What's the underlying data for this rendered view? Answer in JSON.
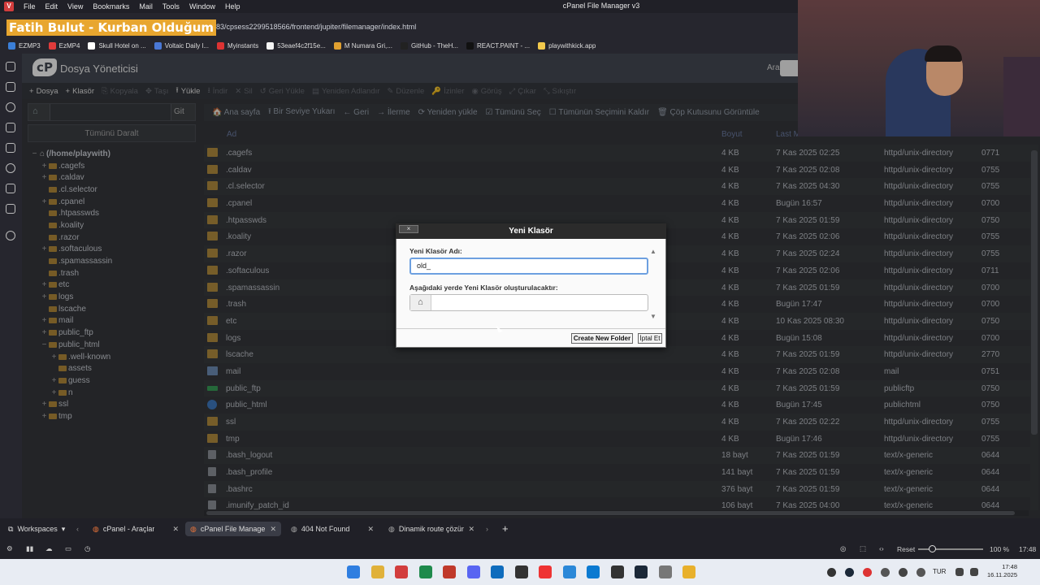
{
  "menubar": {
    "items": [
      "File",
      "Edit",
      "View",
      "Bookmarks",
      "Mail",
      "Tools",
      "Window",
      "Help"
    ],
    "window_title": "cPanel File Manager v3"
  },
  "overlay": {
    "streamer_name": "Fatih Bulut - Kurban Olduğum"
  },
  "address": {
    "url": ".app:2083/cpsess2299518566/frontend/jupiter/filemanager/index.html"
  },
  "bookmarks": [
    {
      "label": "EZMP3",
      "color": "#3b7fd8"
    },
    {
      "label": "EzMP4",
      "color": "#e03b3b"
    },
    {
      "label": "Skull Hotel on ...",
      "color": "#ffffff"
    },
    {
      "label": "Voltaic Daily l...",
      "color": "#4a78d6"
    },
    {
      "label": "Myinstants",
      "color": "#d33"
    },
    {
      "label": "53eaef4c2f15e...",
      "color": "#f5f5f5"
    },
    {
      "label": "M Numara Gri,...",
      "color": "#e0a030"
    },
    {
      "label": "GitHub - TheH...",
      "color": "#222"
    },
    {
      "label": "REACT.PAINT - ...",
      "color": "#111"
    },
    {
      "label": "playwithkick.app",
      "color": "#f2c94c"
    }
  ],
  "cpanel": {
    "logo_text": "cP",
    "title": "Dosya Yöneticisi",
    "search_label": "Ara",
    "search_placeholder": "Tü"
  },
  "toolbar": [
    {
      "label": "Dosya",
      "icon": "+",
      "enabled": true
    },
    {
      "label": "Klasör",
      "icon": "+",
      "enabled": true
    },
    {
      "label": "Kopyala",
      "icon": "⎘",
      "enabled": false
    },
    {
      "label": "Taşı",
      "icon": "✥",
      "enabled": false
    },
    {
      "label": "Yükle",
      "icon": "⭱",
      "enabled": true
    },
    {
      "label": "İndir",
      "icon": "⭳",
      "enabled": false
    },
    {
      "label": "Sil",
      "icon": "✕",
      "enabled": false
    },
    {
      "label": "Geri Yükle",
      "icon": "↺",
      "enabled": false
    },
    {
      "label": "Yeniden Adlandır",
      "icon": "▤",
      "enabled": false
    },
    {
      "label": "Düzenle",
      "icon": "✎",
      "enabled": false
    },
    {
      "label": "İzinler",
      "icon": "🔑",
      "enabled": false
    },
    {
      "label": "Görüş",
      "icon": "◉",
      "enabled": false
    },
    {
      "label": "Çıkar",
      "icon": "⤢",
      "enabled": false
    },
    {
      "label": "Sıkıştır",
      "icon": "⤡",
      "enabled": false
    }
  ],
  "tree_nav": {
    "go_label": "Git",
    "collapse_label": "Tümünü Daralt"
  },
  "tree": [
    {
      "label": "(/home/playwith)",
      "indent": 0,
      "pm": "−",
      "home": true
    },
    {
      "label": ".cagefs",
      "indent": 1,
      "pm": "+"
    },
    {
      "label": ".caldav",
      "indent": 1,
      "pm": "+"
    },
    {
      "label": ".cl.selector",
      "indent": 1,
      "pm": ""
    },
    {
      "label": ".cpanel",
      "indent": 1,
      "pm": "+"
    },
    {
      "label": ".htpasswds",
      "indent": 1,
      "pm": ""
    },
    {
      "label": ".koality",
      "indent": 1,
      "pm": ""
    },
    {
      "label": ".razor",
      "indent": 1,
      "pm": ""
    },
    {
      "label": ".softaculous",
      "indent": 1,
      "pm": "+"
    },
    {
      "label": ".spamassassin",
      "indent": 1,
      "pm": ""
    },
    {
      "label": ".trash",
      "indent": 1,
      "pm": ""
    },
    {
      "label": "etc",
      "indent": 1,
      "pm": "+"
    },
    {
      "label": "logs",
      "indent": 1,
      "pm": "+"
    },
    {
      "label": "lscache",
      "indent": 1,
      "pm": ""
    },
    {
      "label": "mail",
      "indent": 1,
      "pm": "+"
    },
    {
      "label": "public_ftp",
      "indent": 1,
      "pm": "+"
    },
    {
      "label": "public_html",
      "indent": 1,
      "pm": "−"
    },
    {
      "label": ".well-known",
      "indent": 2,
      "pm": "+"
    },
    {
      "label": "assets",
      "indent": 2,
      "pm": ""
    },
    {
      "label": "guess",
      "indent": 2,
      "pm": "+"
    },
    {
      "label": "n",
      "indent": 2,
      "pm": "+"
    },
    {
      "label": "ssl",
      "indent": 1,
      "pm": "+"
    },
    {
      "label": "tmp",
      "indent": 1,
      "pm": "+"
    }
  ],
  "file_toolbar": [
    "🏠 Ana sayfa",
    "⭱ Bir Seviye Yukarı",
    "← Geri",
    "→ İlerme",
    "⟳ Yeniden yükle",
    "☑ Tümünü Seç",
    "☐ Tümünün Seçimini Kaldır",
    "🗑 Çöp Kutusunu Görüntüle"
  ],
  "table": {
    "headers": {
      "name": "Ad",
      "size": "Boyut",
      "modified": "Last M",
      "type": "",
      "perms": ""
    },
    "rows": [
      {
        "icon": "folder",
        "name": ".cagefs",
        "size": "4 KB",
        "modified": "7 Kas 2025 02:25",
        "type": "httpd/unix-directory",
        "perms": "0771"
      },
      {
        "icon": "folder",
        "name": ".caldav",
        "size": "4 KB",
        "modified": "7 Kas 2025 02:08",
        "type": "httpd/unix-directory",
        "perms": "0755"
      },
      {
        "icon": "folder",
        "name": ".cl.selector",
        "size": "4 KB",
        "modified": "7 Kas 2025 04:30",
        "type": "httpd/unix-directory",
        "perms": "0755"
      },
      {
        "icon": "folder",
        "name": ".cpanel",
        "size": "4 KB",
        "modified": "Bugün 16:57",
        "type": "httpd/unix-directory",
        "perms": "0700"
      },
      {
        "icon": "folder",
        "name": ".htpasswds",
        "size": "4 KB",
        "modified": "7 Kas 2025 01:59",
        "type": "httpd/unix-directory",
        "perms": "0750"
      },
      {
        "icon": "folder",
        "name": ".koality",
        "size": "4 KB",
        "modified": "7 Kas 2025 02:06",
        "type": "httpd/unix-directory",
        "perms": "0755"
      },
      {
        "icon": "folder",
        "name": ".razor",
        "size": "4 KB",
        "modified": "7 Kas 2025 02:24",
        "type": "httpd/unix-directory",
        "perms": "0755"
      },
      {
        "icon": "folder",
        "name": ".softaculous",
        "size": "4 KB",
        "modified": "7 Kas 2025 02:06",
        "type": "httpd/unix-directory",
        "perms": "0711"
      },
      {
        "icon": "folder",
        "name": ".spamassassin",
        "size": "4 KB",
        "modified": "7 Kas 2025 01:59",
        "type": "httpd/unix-directory",
        "perms": "0700"
      },
      {
        "icon": "folder",
        "name": ".trash",
        "size": "4 KB",
        "modified": "Bugün 17:47",
        "type": "httpd/unix-directory",
        "perms": "0700"
      },
      {
        "icon": "folder",
        "name": "etc",
        "size": "4 KB",
        "modified": "10 Kas 2025 08:30",
        "type": "httpd/unix-directory",
        "perms": "0750"
      },
      {
        "icon": "folder",
        "name": "logs",
        "size": "4 KB",
        "modified": "Bugün 15:08",
        "type": "httpd/unix-directory",
        "perms": "0700"
      },
      {
        "icon": "folder",
        "name": "lscache",
        "size": "4 KB",
        "modified": "7 Kas 2025 01:59",
        "type": "httpd/unix-directory",
        "perms": "2770"
      },
      {
        "icon": "mail",
        "name": "mail",
        "size": "4 KB",
        "modified": "7 Kas 2025 02:08",
        "type": "mail",
        "perms": "0751"
      },
      {
        "icon": "ftp",
        "name": "public_ftp",
        "size": "4 KB",
        "modified": "7 Kas 2025 01:59",
        "type": "publicftp",
        "perms": "0750"
      },
      {
        "icon": "globe",
        "name": "public_html",
        "size": "4 KB",
        "modified": "Bugün 17:45",
        "type": "publichtml",
        "perms": "0750"
      },
      {
        "icon": "folder",
        "name": "ssl",
        "size": "4 KB",
        "modified": "7 Kas 2025 02:22",
        "type": "httpd/unix-directory",
        "perms": "0755"
      },
      {
        "icon": "folder",
        "name": "tmp",
        "size": "4 KB",
        "modified": "Bugün 17:46",
        "type": "httpd/unix-directory",
        "perms": "0755"
      },
      {
        "icon": "file",
        "name": ".bash_logout",
        "size": "18 bayt",
        "modified": "7 Kas 2025 01:59",
        "type": "text/x-generic",
        "perms": "0644"
      },
      {
        "icon": "file",
        "name": ".bash_profile",
        "size": "141 bayt",
        "modified": "7 Kas 2025 01:59",
        "type": "text/x-generic",
        "perms": "0644"
      },
      {
        "icon": "file",
        "name": ".bashrc",
        "size": "376 bayt",
        "modified": "7 Kas 2025 01:59",
        "type": "text/x-generic",
        "perms": "0644"
      },
      {
        "icon": "file",
        "name": ".imunify_patch_id",
        "size": "106 bayt",
        "modified": "7 Kas 2025 04:00",
        "type": "text/x-generic",
        "perms": "0644"
      }
    ]
  },
  "dialog": {
    "title": "Yeni Klasör",
    "close_label": "×",
    "name_label": "Yeni Klasör Adı:",
    "name_value": "old_",
    "location_label": "Aşağıdaki yerde Yeni Klasör oluşturulacaktır:",
    "location_value": "",
    "create_label": "Create New Folder",
    "cancel_label": "İptal Et"
  },
  "tabs": {
    "workspaces": "Workspaces",
    "items": [
      {
        "label": "cPanel - Araçlar",
        "active": false
      },
      {
        "label": "cPanel File Manager v3",
        "active": true
      },
      {
        "label": "404 Not Found",
        "active": false
      },
      {
        "label": "Dinamik route çözümü",
        "active": false
      }
    ]
  },
  "status": {
    "reset": "Reset",
    "zoom": "100 %",
    "time": "17:48"
  },
  "taskbar": {
    "lang": "TUR",
    "time": "17:48",
    "date": "16.11.2025",
    "apps": [
      "windows-icon",
      "chrome-icon",
      "vivaldi-icon",
      "terminal-icon",
      "filezilla-icon",
      "discord-icon",
      "app-icon",
      "gpu-icon",
      "youtube-icon",
      "explorer-icon",
      "edge-icon",
      "obs-icon",
      "steam-icon",
      "tool-icon",
      "folder-icon"
    ]
  }
}
